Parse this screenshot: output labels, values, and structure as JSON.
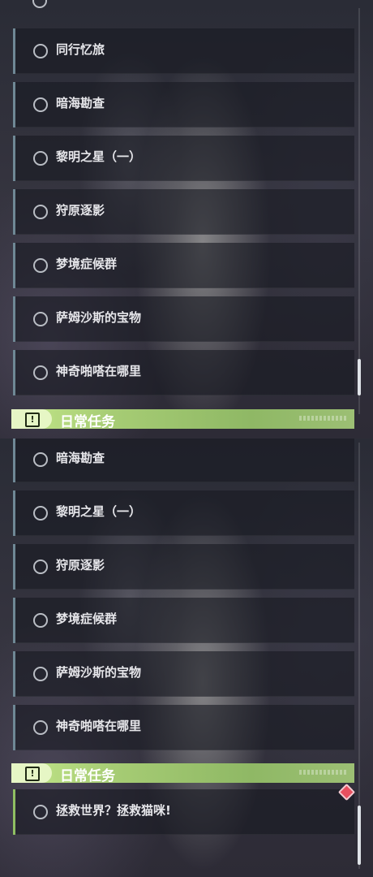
{
  "top_panel": {
    "items": [
      {
        "label": "同行忆旅"
      },
      {
        "label": "暗海勘查"
      },
      {
        "label": "黎明之星（一）"
      },
      {
        "label": "狩原逐影"
      },
      {
        "label": "梦境症候群"
      },
      {
        "label": "萨姆沙斯的宝物"
      },
      {
        "label": "神奇啪嗒在哪里"
      }
    ],
    "section_title": "日常任务"
  },
  "bottom_panel": {
    "items": [
      {
        "label": "暗海勘查"
      },
      {
        "label": "黎明之星（一）"
      },
      {
        "label": "狩原逐影"
      },
      {
        "label": "梦境症候群"
      },
      {
        "label": "萨姆沙斯的宝物"
      },
      {
        "label": "神奇啪嗒在哪里"
      }
    ],
    "section_title": "日常任务",
    "daily_items": [
      {
        "label": "拯救世界？拯救猫咪!"
      }
    ]
  },
  "icons": {
    "status": "circle-outline-icon",
    "section": "exclamation-box-icon",
    "alert": "red-diamond-icon"
  },
  "colors": {
    "accent_green": "#a6cc74",
    "accent_blue": "#6f8895",
    "alert_red": "#e8505f"
  }
}
